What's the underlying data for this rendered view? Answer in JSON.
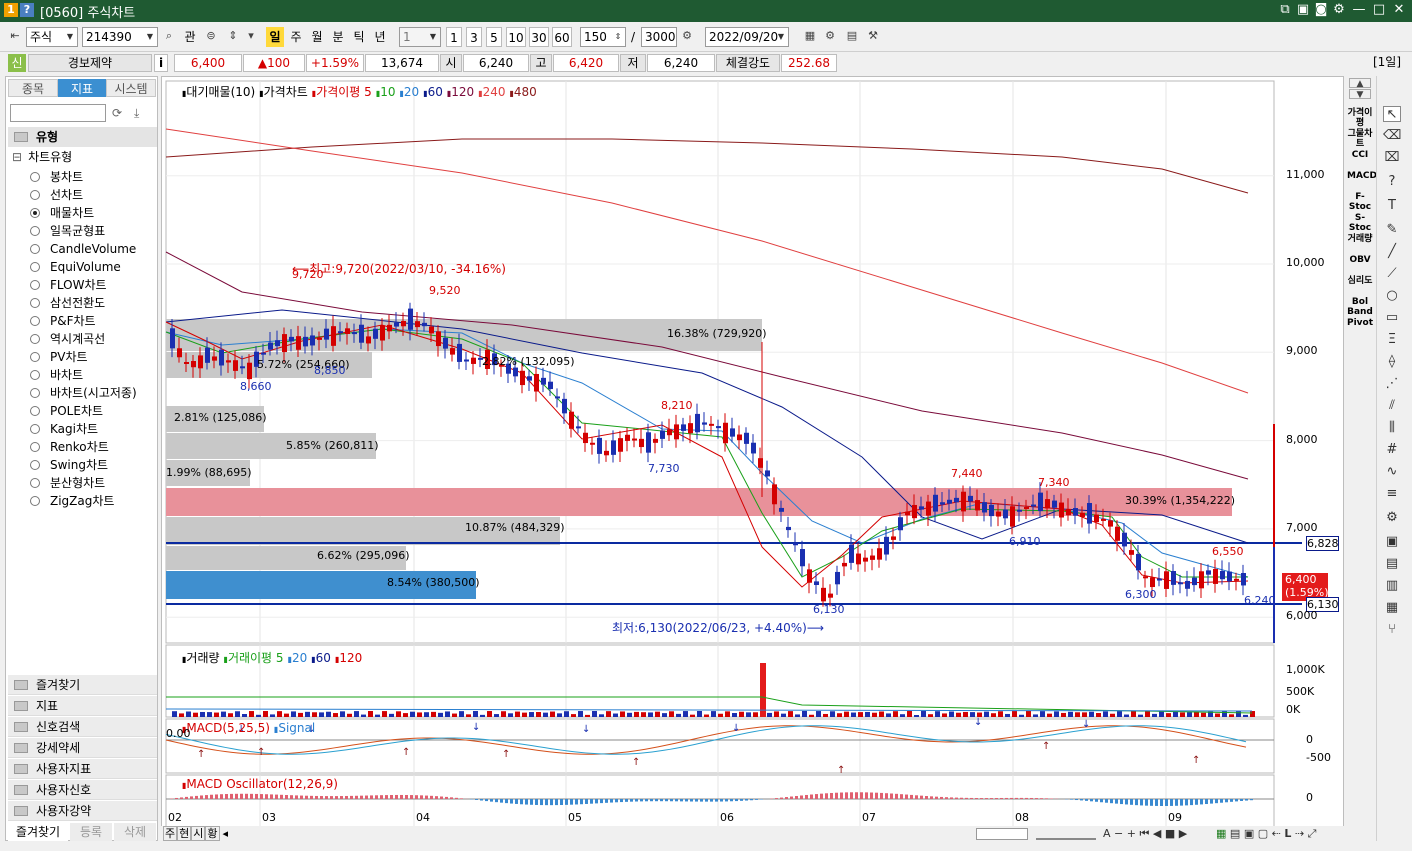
{
  "window": {
    "badge1": "1",
    "badge2": "?",
    "title": "[0560] 주식차트"
  },
  "toolbar": {
    "market": "주식",
    "code": "214390",
    "btn_gwan": "관",
    "periods": [
      "일",
      "주",
      "월",
      "분",
      "틱",
      "년"
    ],
    "period_count": "1",
    "quick": [
      "1",
      "3",
      "5",
      "10",
      "30",
      "60"
    ],
    "view_count": "150",
    "slash": "/",
    "total_count": "3000",
    "date": "2022/09/20"
  },
  "infobar": {
    "badge": "신",
    "name": "경보제약",
    "info_icon": "i",
    "price": "6,400",
    "change": "▲100",
    "change_pct": "+1.59%",
    "volume": "13,674",
    "open_label": "시",
    "open": "6,240",
    "high_label": "고",
    "high": "6,420",
    "low_label": "저",
    "low": "6,240",
    "strength_label": "체결강도",
    "strength": "252.68",
    "period_tag": "[1일]"
  },
  "leftpanel": {
    "tabs": [
      "종목",
      "지표",
      "시스템"
    ],
    "section": "유형",
    "tree_root": "차트유형",
    "chart_types": [
      "봉차트",
      "선차트",
      "매물차트",
      "일목균형표",
      "CandleVolume",
      "EquiVolume",
      "FLOW차트",
      "삼선전환도",
      "P&F차트",
      "역시계곡선",
      "PV차트",
      "바차트",
      "바차트(시고저종)",
      "POLE차트",
      "Kagi차트",
      "Renko차트",
      "Swing차트",
      "분산형차트",
      "ZigZag차트"
    ],
    "selected": "매물차트",
    "folders": [
      "즐겨찾기",
      "지표",
      "신호검색",
      "강세약세",
      "사용자지표",
      "사용자신호",
      "사용자강약"
    ],
    "bottom_tabs": [
      "즐겨찾기",
      "등록",
      "삭제"
    ]
  },
  "main_pane": {
    "legend": [
      {
        "text": "대기매물(10)",
        "color": "#000000"
      },
      {
        "text": "가격차트",
        "color": "#000000"
      },
      {
        "text": "가격이평 5",
        "color": "#d40000"
      },
      {
        "text": "10",
        "color": "#1aa01a"
      },
      {
        "text": "20",
        "color": "#2a7fd0"
      },
      {
        "text": "60",
        "color": "#0a1a8a"
      },
      {
        "text": "120",
        "color": "#7a0a3a"
      },
      {
        "text": "240",
        "color": "#e04040"
      },
      {
        "text": "480",
        "color": "#8a1a1a"
      }
    ],
    "y_ticks": [
      "11,000",
      "10,000",
      "9,000",
      "8,000",
      "7,000",
      "6,000"
    ],
    "profile_bars": [
      {
        "label": "16.38% (729,920)"
      },
      {
        "label": "5.72% (254,660)"
      },
      {
        "label": "2.81% (125,086)"
      },
      {
        "label": "5.85% (260,811)"
      },
      {
        "label": "1.99% (88,695)"
      },
      {
        "label": "30.39% (1,354,222)"
      },
      {
        "label": "10.87% (484,329)"
      },
      {
        "label": "6.62% (295,096)"
      },
      {
        "label": "8.54% (380,500)"
      },
      {
        "label": "2.82% (132,095)"
      }
    ],
    "high_note": "최고:9,720(2022/03/10, -34.16%)",
    "low_note": "최저:6,130(2022/06/23, +4.40%)",
    "price_labels": [
      "9,720",
      "9,520",
      "8,660",
      "8,850",
      "8,210",
      "7,730",
      "7,440",
      "7,340",
      "6,910",
      "6,550",
      "6,300",
      "6,130",
      "6,240"
    ],
    "right_tags": {
      "upper_line": "6,828",
      "current": "6,400",
      "current_pct": "(1.59%)",
      "lower_line": "6,130"
    }
  },
  "volume_pane": {
    "legend": [
      {
        "text": "거래량",
        "color": "#000000"
      },
      {
        "text": "거래이평 5",
        "color": "#1aa01a"
      },
      {
        "text": "20",
        "color": "#2a7fd0"
      },
      {
        "text": "60",
        "color": "#0a1a8a"
      },
      {
        "text": "120",
        "color": "#d40000"
      }
    ],
    "y_ticks": [
      "1,000K",
      "500K",
      "0K"
    ]
  },
  "macd_pane": {
    "legend": [
      {
        "text": "MACD(5,25,5)",
        "color": "#d40000"
      },
      {
        "text": "Signal",
        "color": "#2a7fd0"
      }
    ],
    "left_value": "0.00",
    "y_ticks": [
      "0",
      "-500"
    ]
  },
  "osc_pane": {
    "legend": [
      {
        "text": "MACD Oscillator(12,26,9)",
        "color": "#d40000"
      }
    ],
    "y_ticks": [
      "0"
    ]
  },
  "x_axis": {
    "labels": [
      "02",
      "03",
      "04",
      "05",
      "06",
      "07",
      "08",
      "09"
    ]
  },
  "right_indicators": [
    "가격이평",
    "그물차트",
    "CCI",
    "MACD",
    "F-Stoc",
    "S-Stoc",
    "거래량",
    "OBV",
    "심리도",
    "Bol Band",
    "Pivot"
  ],
  "bottombar": {
    "left_tabs": [
      "주",
      "현",
      "시",
      "황"
    ]
  },
  "colors": {
    "titlebar": "#1f5a32",
    "up": "#d40000",
    "down": "#1a2fb0",
    "profile_gray": "#c8c8c8",
    "profile_red": "#e8919a",
    "profile_blue": "#3f8fcf"
  }
}
